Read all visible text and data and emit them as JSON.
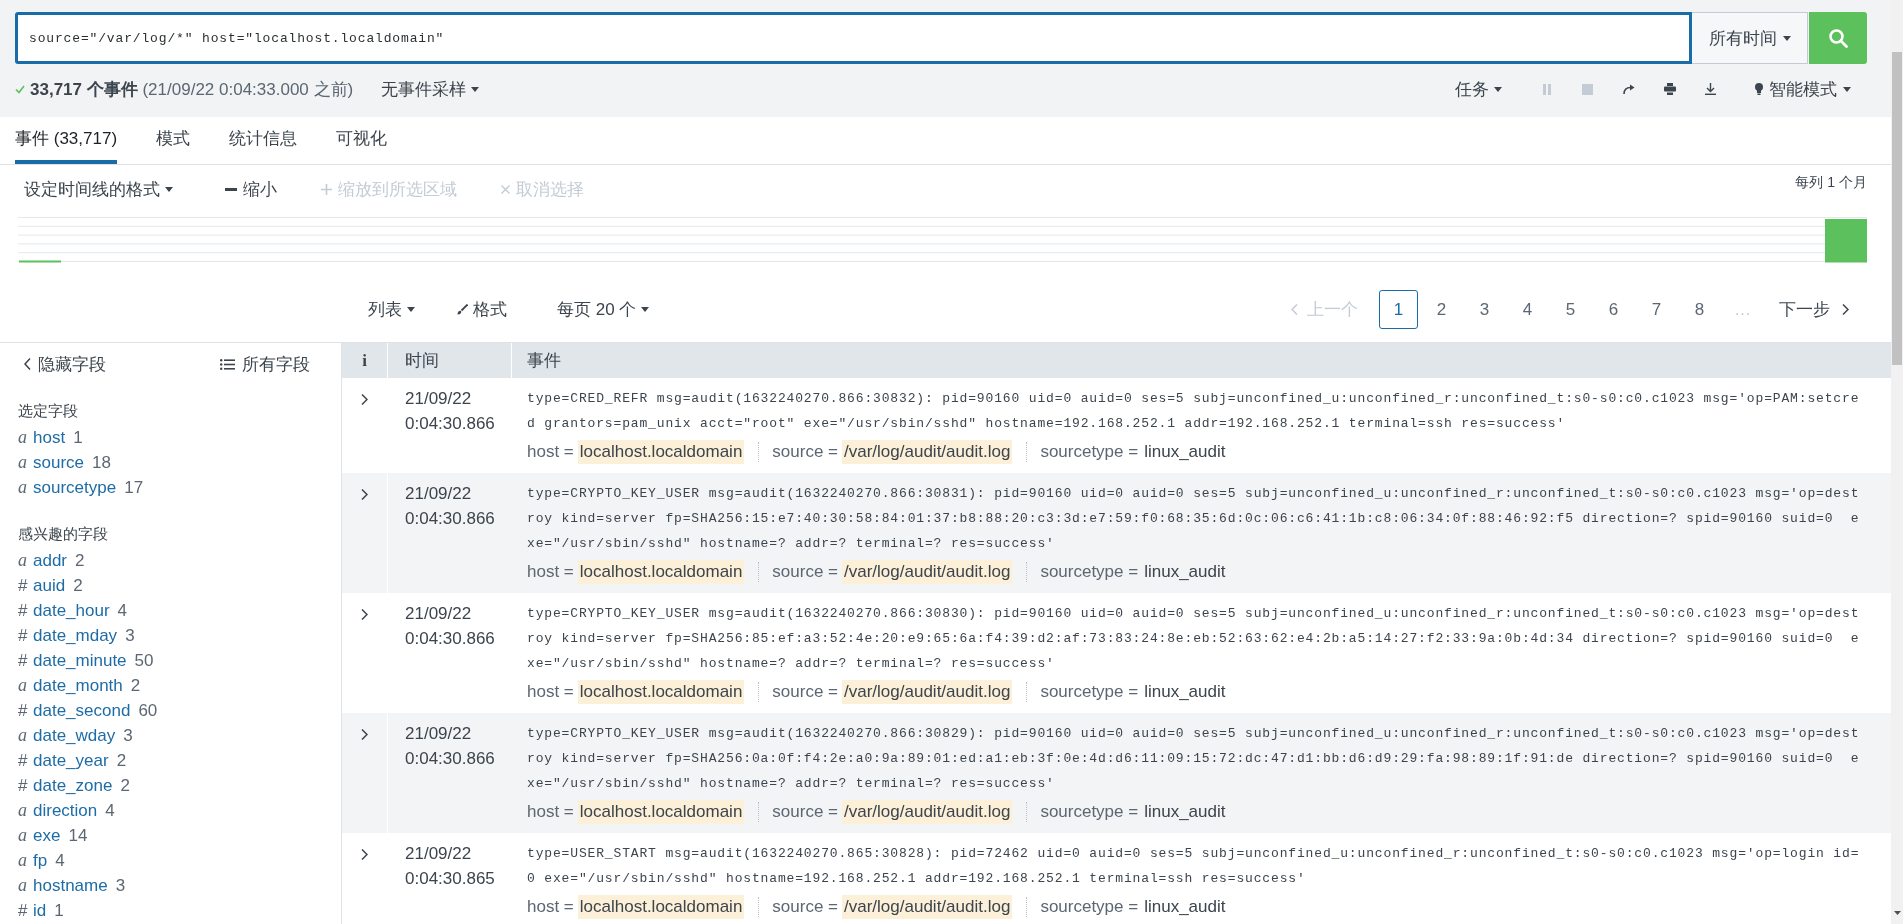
{
  "search": {
    "query": "source=\"/var/log/*\" host=\"localhost.localdomain\"",
    "time_range": "所有时间"
  },
  "status": {
    "summary": "**33,717 个事件** (21/09/22 0:04:33.000 之前)",
    "sampling": "无事件采样",
    "job_menu": "任务",
    "job_controls": [
      {
        "disabled": true
      },
      {
        "disabled": true
      },
      {
        "disabled": false
      },
      {
        "disabled": false
      },
      {
        "disabled": false
      }
    ],
    "search_mode": "智能模式"
  },
  "tabs": [
    {
      "label": "事件 (33,717)",
      "selected": true
    },
    {
      "label": "模式",
      "selected": false
    },
    {
      "label": "统计信息",
      "selected": false
    },
    {
      "label": "可视化",
      "selected": false
    }
  ],
  "timeline": {
    "format_menu": "设定时间线的格式",
    "actions": [
      {
        "label": "缩小",
        "disabled": false
      },
      {
        "label": "缩放到所选区域",
        "disabled": true
      },
      {
        "label": "取消选择",
        "disabled": true
      }
    ],
    "bucket_note": "每列 1 个月"
  },
  "pager": {
    "view_menu": "列表",
    "format_button": "格式",
    "per_page_menu": "每页 20 个",
    "previous": {
      "label": "上一个",
      "disabled": true
    },
    "pages": [
      {
        "label": "1",
        "selected": true
      },
      {
        "label": "2",
        "selected": false
      },
      {
        "label": "3",
        "selected": false
      },
      {
        "label": "4",
        "selected": false
      },
      {
        "label": "5",
        "selected": false
      },
      {
        "label": "6",
        "selected": false
      },
      {
        "label": "7",
        "selected": false
      },
      {
        "label": "8",
        "selected": false
      }
    ],
    "ellipsis": "…",
    "next": {
      "label": "下一步",
      "disabled": false
    }
  },
  "sidebar": {
    "hide_fields": "隐藏字段",
    "all_fields": "所有字段",
    "groups": [
      {
        "title": "选定字段",
        "fields": [
          {
            "kind": "string",
            "mark": "a",
            "name": "host",
            "count": "1"
          },
          {
            "kind": "string",
            "mark": "a",
            "name": "source",
            "count": "18"
          },
          {
            "kind": "string",
            "mark": "a",
            "name": "sourcetype",
            "count": "17"
          }
        ]
      },
      {
        "title": "感兴趣的字段",
        "fields": [
          {
            "kind": "string",
            "mark": "a",
            "name": "addr",
            "count": "2"
          },
          {
            "kind": "number",
            "mark": "#",
            "name": "auid",
            "count": "2"
          },
          {
            "kind": "number",
            "mark": "#",
            "name": "date_hour",
            "count": "4"
          },
          {
            "kind": "number",
            "mark": "#",
            "name": "date_mday",
            "count": "3"
          },
          {
            "kind": "number",
            "mark": "#",
            "name": "date_minute",
            "count": "50"
          },
          {
            "kind": "string",
            "mark": "a",
            "name": "date_month",
            "count": "2"
          },
          {
            "kind": "number",
            "mark": "#",
            "name": "date_second",
            "count": "60"
          },
          {
            "kind": "string",
            "mark": "a",
            "name": "date_wday",
            "count": "3"
          },
          {
            "kind": "number",
            "mark": "#",
            "name": "date_year",
            "count": "2"
          },
          {
            "kind": "number",
            "mark": "#",
            "name": "date_zone",
            "count": "2"
          },
          {
            "kind": "string",
            "mark": "a",
            "name": "direction",
            "count": "4"
          },
          {
            "kind": "string",
            "mark": "a",
            "name": "exe",
            "count": "14"
          },
          {
            "kind": "string",
            "mark": "a",
            "name": "fp",
            "count": "4"
          },
          {
            "kind": "string",
            "mark": "a",
            "name": "hostname",
            "count": "3"
          },
          {
            "kind": "number",
            "mark": "#",
            "name": "id",
            "count": "1"
          }
        ]
      }
    ]
  },
  "table": {
    "columns": [
      "i",
      "时间",
      "事件"
    ],
    "rows": [
      {
        "expanded": false,
        "date": "21/09/22",
        "time": "0:04:30.866",
        "text": "type=CRED_REFR msg=audit(1632240270.866:30832): pid=90160 uid=0 auid=0 ses=5 subj=unconfined_u:unconfined_r:unconfined_t:s0-s0:c0.c1023 msg='op=PAM:setcred grantors=pam_unix acct=\"root\" exe=\"/usr/sbin/sshd\" hostname=192.168.252.1 addr=192.168.252.1 terminal=ssh res=success'",
        "fields": [
          {
            "label": "host =",
            "value": "localhost.localdomain",
            "highlighted": true
          },
          {
            "label": "source =",
            "value": "/var/log/audit/audit.log",
            "highlighted": true
          },
          {
            "label": "sourcetype =",
            "value": "linux_audit",
            "highlighted": false
          }
        ]
      },
      {
        "expanded": false,
        "date": "21/09/22",
        "time": "0:04:30.866",
        "text": "type=CRYPTO_KEY_USER msg=audit(1632240270.866:30831): pid=90160 uid=0 auid=0 ses=5 subj=unconfined_u:unconfined_r:unconfined_t:s0-s0:c0.c1023 msg='op=destroy kind=server fp=SHA256:15:e7:40:30:58:84:01:37:b8:88:20:c3:3d:e7:59:f0:68:35:6d:0c:06:c6:41:1b:c8:06:34:0f:88:46:92:f5 direction=? spid=90160 suid=0  exe=\"/usr/sbin/sshd\" hostname=? addr=? terminal=? res=success'",
        "fields": [
          {
            "label": "host =",
            "value": "localhost.localdomain",
            "highlighted": true
          },
          {
            "label": "source =",
            "value": "/var/log/audit/audit.log",
            "highlighted": true
          },
          {
            "label": "sourcetype =",
            "value": "linux_audit",
            "highlighted": false
          }
        ]
      },
      {
        "expanded": false,
        "date": "21/09/22",
        "time": "0:04:30.866",
        "text": "type=CRYPTO_KEY_USER msg=audit(1632240270.866:30830): pid=90160 uid=0 auid=0 ses=5 subj=unconfined_u:unconfined_r:unconfined_t:s0-s0:c0.c1023 msg='op=destroy kind=server fp=SHA256:85:ef:a3:52:4e:20:e9:65:6a:f4:39:d2:af:73:83:24:8e:eb:52:63:62:e4:2b:a5:14:27:f2:33:9a:0b:4d:34 direction=? spid=90160 suid=0  exe=\"/usr/sbin/sshd\" hostname=? addr=? terminal=? res=success'",
        "fields": [
          {
            "label": "host =",
            "value": "localhost.localdomain",
            "highlighted": true
          },
          {
            "label": "source =",
            "value": "/var/log/audit/audit.log",
            "highlighted": true
          },
          {
            "label": "sourcetype =",
            "value": "linux_audit",
            "highlighted": false
          }
        ]
      },
      {
        "expanded": false,
        "date": "21/09/22",
        "time": "0:04:30.866",
        "text": "type=CRYPTO_KEY_USER msg=audit(1632240270.866:30829): pid=90160 uid=0 auid=0 ses=5 subj=unconfined_u:unconfined_r:unconfined_t:s0-s0:c0.c1023 msg='op=destroy kind=server fp=SHA256:0a:0f:f4:2e:a0:9a:89:01:ed:a1:eb:3f:0e:4d:d6:11:09:15:72:dc:47:d1:bb:d6:d9:29:fa:98:89:1f:91:de direction=? spid=90160 suid=0  exe=\"/usr/sbin/sshd\" hostname=? addr=? terminal=? res=success'",
        "fields": [
          {
            "label": "host =",
            "value": "localhost.localdomain",
            "highlighted": true
          },
          {
            "label": "source =",
            "value": "/var/log/audit/audit.log",
            "highlighted": true
          },
          {
            "label": "sourcetype =",
            "value": "linux_audit",
            "highlighted": false
          }
        ]
      },
      {
        "expanded": false,
        "date": "21/09/22",
        "time": "0:04:30.865",
        "text": "type=USER_START msg=audit(1632240270.865:30828): pid=72462 uid=0 auid=0 ses=5 subj=unconfined_u:unconfined_r:unconfined_t:s0-s0:c0.c1023 msg='op=login id=0 exe=\"/usr/sbin/sshd\" hostname=192.168.252.1 addr=192.168.252.1 terminal=ssh res=success'",
        "fields": [
          {
            "label": "host =",
            "value": "localhost.localdomain",
            "highlighted": true
          },
          {
            "label": "source =",
            "value": "/var/log/audit/audit.log",
            "highlighted": true
          },
          {
            "label": "sourcetype =",
            "value": "linux_audit",
            "highlighted": false
          }
        ]
      }
    ]
  }
}
